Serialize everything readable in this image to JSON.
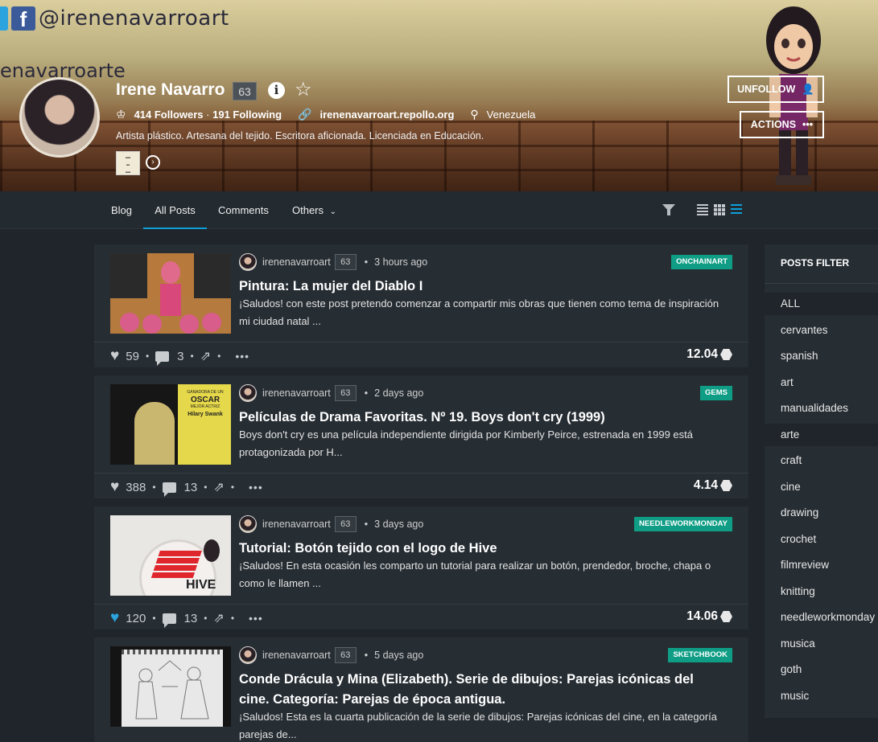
{
  "cover": {
    "handle": "@irenenavarroart",
    "name_text": "enavarroarte"
  },
  "profile": {
    "name": "Irene Navarro",
    "reputation": "63",
    "followers": "414 Followers",
    "following": "191 Following",
    "website": "irenenavarroart.repollo.org",
    "location": "Venezuela",
    "about": "Artista plástico. Artesana del tejido. Escritora aficionada. Licenciada en Educación.",
    "unfollow_label": "UNFOLLOW",
    "actions_label": "ACTIONS"
  },
  "tabs": {
    "blog": "Blog",
    "all_posts": "All Posts",
    "comments": "Comments",
    "others": "Others"
  },
  "posts": [
    {
      "author": "irenenavarroart",
      "rep": "63",
      "time": "3 hours ago",
      "tag": "ONCHAINART",
      "title": "Pintura: La mujer del Diablo I",
      "excerpt": "¡Saludos! con este post pretendo comenzar a compartir mis obras que tienen como tema de inspiración mi ciudad natal ...",
      "votes": "59",
      "comments": "3",
      "payout": "12.04",
      "voted": false
    },
    {
      "author": "irenenavarroart",
      "rep": "63",
      "time": "2 days ago",
      "tag": "GEMS",
      "title": "Películas de Drama Favoritas. Nº 19. Boys don't cry (1999)",
      "excerpt": "Boys don't cry es una película independiente dirigida por Kimberly Peirce, estrenada en 1999 está protagonizada por H...",
      "votes": "388",
      "comments": "13",
      "payout": "4.14",
      "voted": false
    },
    {
      "author": "irenenavarroart",
      "rep": "63",
      "time": "3 days ago",
      "tag": "NEEDLEWORKMONDAY",
      "title": "Tutorial: Botón tejido con el logo de Hive",
      "excerpt": "¡Saludos! En esta ocasión les comparto un tutorial para realizar un botón, prendedor, broche, chapa o como le llamen ...",
      "votes": "120",
      "comments": "13",
      "payout": "14.06",
      "voted": true
    },
    {
      "author": "irenenavarroart",
      "rep": "63",
      "time": "5 days ago",
      "tag": "SKETCHBOOK",
      "title": "Conde Drácula y Mina (Elizabeth). Serie de dibujos: Parejas icónicas del cine. Categoría: Parejas de época antigua.",
      "excerpt": "¡Saludos! Esta es la cuarta publicación de la serie de dibujos: Parejas icónicas del cine, en la categoría parejas de..."
    }
  ],
  "thumb_text": {
    "movie_top": "GANADORA DE UN",
    "movie_oscar": "OSCAR",
    "movie_sub": "MEJOR ACTRIZ",
    "movie_actress": "Hilary Swank",
    "hive_word": "HIVE"
  },
  "posts_filter": {
    "title": "POSTS FILTER",
    "items": [
      "ALL",
      "cervantes",
      "spanish",
      "art",
      "manualidades",
      "arte",
      "craft",
      "cine",
      "drawing",
      "crochet",
      "filmreview",
      "knitting",
      "needleworkmonday",
      "musica",
      "goth",
      "music"
    ],
    "highlighted": [
      "ALL",
      "arte"
    ]
  },
  "colors": {
    "accent": "#0d9fd8",
    "tag_green": "#0f9d85",
    "panel": "#262d33",
    "background": "#1f252a"
  }
}
